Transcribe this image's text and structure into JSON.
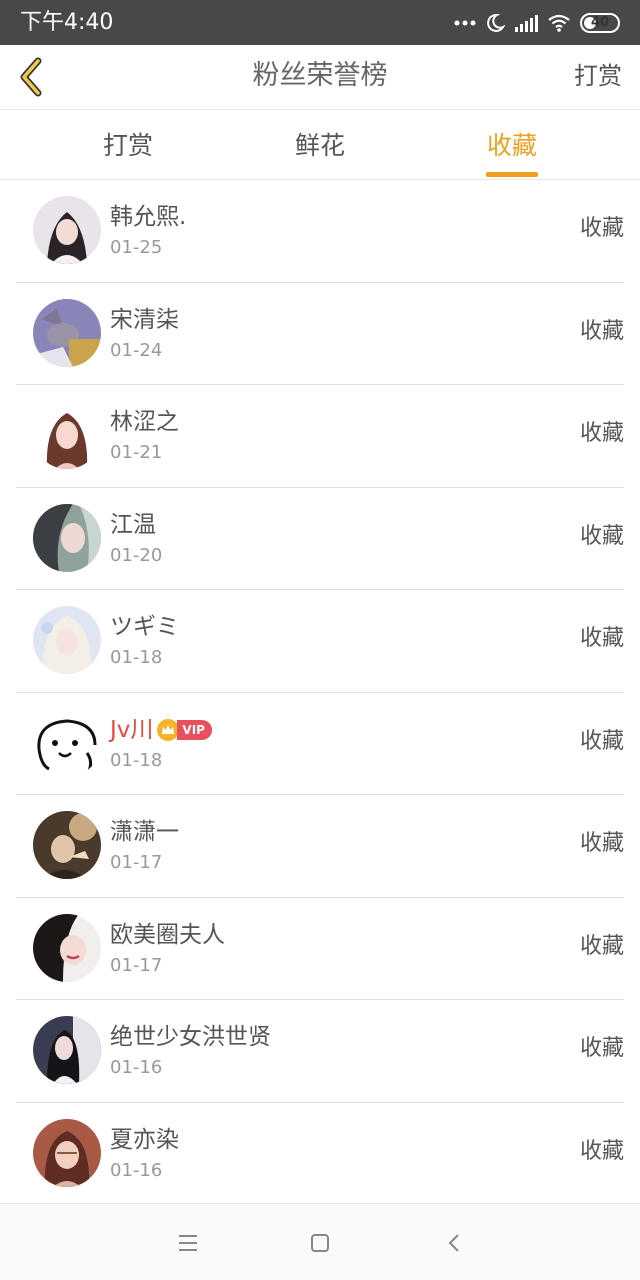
{
  "status": {
    "time": "下午4:40",
    "battery": "40",
    "battery_level": 0.4
  },
  "header": {
    "title": "粉丝荣誉榜",
    "right_action": "打赏",
    "back_icon": "chevron-left-icon"
  },
  "tabs": [
    {
      "label": "打赏",
      "active": false
    },
    {
      "label": "鲜花",
      "active": false
    },
    {
      "label": "收藏",
      "active": true
    }
  ],
  "colors": {
    "accent": "#f0a020",
    "vip_name": "#e54a3a",
    "vip_badge": "#e9505b",
    "status_bar": "#484848"
  },
  "fans": [
    {
      "name": "韩允熙.",
      "date": "01-25",
      "action": "收藏"
    },
    {
      "name": "宋清柒",
      "date": "01-24",
      "action": "收藏"
    },
    {
      "name": "林涩之",
      "date": "01-21",
      "action": "收藏"
    },
    {
      "name": "江温",
      "date": "01-20",
      "action": "收藏"
    },
    {
      "name": "ツギミ",
      "date": "01-18",
      "action": "收藏"
    },
    {
      "name": "Jv川",
      "date": "01-18",
      "action": "收藏",
      "vip": "VIP"
    },
    {
      "name": "潇潇一",
      "date": "01-17",
      "action": "收藏"
    },
    {
      "name": "欧美圈夫人",
      "date": "01-17",
      "action": "收藏"
    },
    {
      "name": "绝世少女洪世贤",
      "date": "01-16",
      "action": "收藏"
    },
    {
      "name": "夏亦染",
      "date": "01-16",
      "action": "收藏"
    }
  ],
  "nav": {
    "menu_icon": "menu-icon",
    "home_icon": "home-square-icon",
    "back_icon": "back-triangle-icon"
  }
}
